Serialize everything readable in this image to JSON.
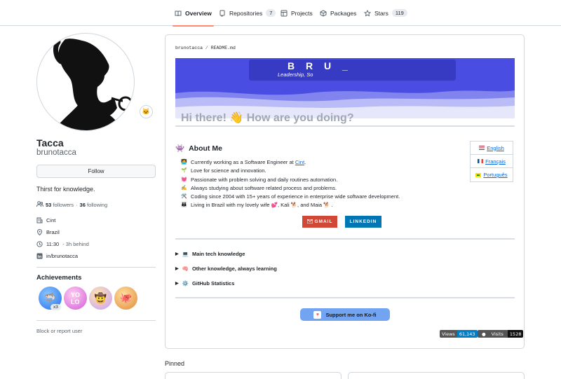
{
  "nav": {
    "tabs": [
      {
        "label": "Overview",
        "icon": "book-icon"
      },
      {
        "label": "Repositories",
        "icon": "repo-icon",
        "count": "7"
      },
      {
        "label": "Projects",
        "icon": "table-icon"
      },
      {
        "label": "Packages",
        "icon": "package-icon"
      },
      {
        "label": "Stars",
        "icon": "star-icon",
        "count": "119"
      }
    ]
  },
  "profile": {
    "name": "Tacca",
    "username": "brunotacca",
    "follow_label": "Follow",
    "bio": "Thirst for knowledge.",
    "followers_count": "53",
    "followers_label": "followers",
    "dot": "·",
    "following_count": "36",
    "following_label": "following",
    "company": "Cint",
    "location": "Brazil",
    "time": "11:30",
    "time_note": "- 3h behind",
    "linkedin": "in/brunotacca",
    "achievements_title": "Achievements",
    "achievement_multiplier": "x3",
    "block_label": "Block or report user"
  },
  "readme": {
    "crumb_user": "brunotacca",
    "crumb_sep": "/",
    "crumb_file": "README.md",
    "banner_title": "B R U _",
    "banner_subtitle": "Leadership, So",
    "greeting": "Hi there! 👋 How are you doing?",
    "about_emoji": "👾",
    "about_title": "About Me",
    "languages": [
      {
        "label": "English",
        "flag_color": "#3c3b6e"
      },
      {
        "label": "Français",
        "flag_color": "#0055a4"
      },
      {
        "label": "Português",
        "flag_color": "#009c3b"
      }
    ],
    "bullets": [
      {
        "emoji": "🧑‍💻",
        "pre": "Currently working as a Software Engineer at ",
        "link": "Cint",
        "post": "."
      },
      {
        "emoji": "🌱",
        "pre": "Love for science and innovation.",
        "link": "",
        "post": ""
      },
      {
        "emoji": "💓",
        "pre": "Passionate with problem solving and daily routines automation.",
        "link": "",
        "post": ""
      },
      {
        "emoji": "✍️",
        "pre": "Always studying about software related process and problems.",
        "link": "",
        "post": ""
      },
      {
        "emoji": "🛠️",
        "pre": "Coding since 2004 with 15+ years of experience in enterprise wide software development.",
        "link": "",
        "post": ""
      },
      {
        "emoji": "👪",
        "pre": "Living in Brazil with my lovely wife 💕, Kali 🐕, and Maia 🐕 .",
        "link": "",
        "post": ""
      }
    ],
    "gmail_label": "GMAIL",
    "linkedin_label": "LINKEDIN",
    "details": [
      {
        "emoji": "💻",
        "label": "Main tech knowledge"
      },
      {
        "emoji": "🧠",
        "label": "Other knowledge, always learning"
      },
      {
        "emoji": "⚙️",
        "label": "GitHub Statistics"
      }
    ],
    "kofi_label": "Support me on Ko-fi",
    "views_label": "Views",
    "views_value": "61,143",
    "visits_label": "Visits",
    "visits_value": "1528"
  },
  "pinned_title": "Pinned",
  "colors": {
    "accent_underline": "#fd8c73",
    "link": "#0969da",
    "banner": "#4a4de2",
    "gmail": "#d14836",
    "linkedin": "#0077b5",
    "kofi": "#72a4f2"
  }
}
